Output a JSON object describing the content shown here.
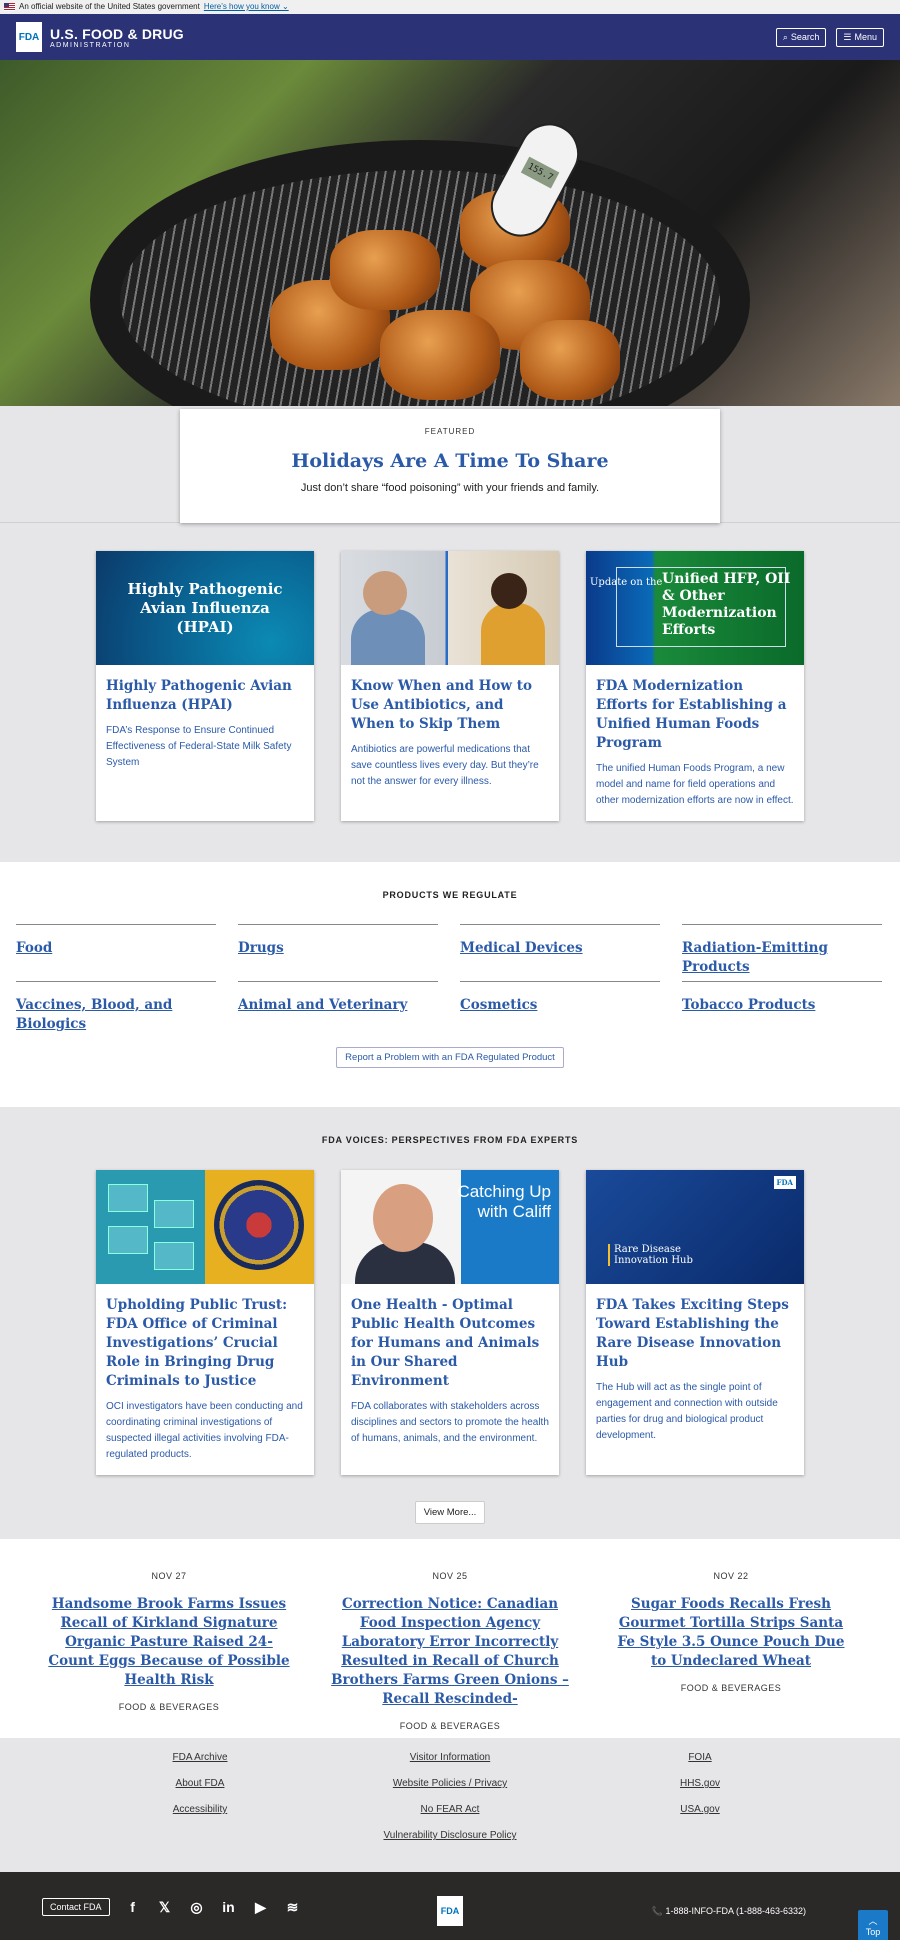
{
  "gov_banner": {
    "text": "An official website of the United States government",
    "link": "Here’s how you know ⌄"
  },
  "header": {
    "logo": "FDA",
    "title": "U.S. FOOD & DRUG",
    "subtitle": "ADMINISTRATION",
    "search_label": "Search",
    "menu_label": "Menu"
  },
  "hero": {
    "thermometer": "155.7"
  },
  "featured": {
    "kicker": "FEATURED",
    "title": "Holidays Are A Time To Share",
    "text": "Just don’t share “food poisoning” with your friends and family."
  },
  "top_cards": [
    {
      "image_text": "Highly Pathogenic Avian Influenza (HPAI)",
      "title": "Highly Pathogenic Avian Influenza (HPAI)",
      "text": "FDA’s Response to Ensure Continued Effectiveness of Federal-State Milk Safety System"
    },
    {
      "title": "Know When and How to Use Antibiotics, and When to Skip Them",
      "text": "Antibiotics are powerful medications that save countless lives every day. But they’re not the answer for every illness."
    },
    {
      "image_small": "Update on the",
      "image_big": "Unified HFP, OII & Other Modernization Efforts",
      "title": "FDA Modernization Efforts for Establishing a Unified Human Foods Program",
      "text": "The unified Human Foods Program, a new model and name for field operations and other modernization efforts are now in effect."
    }
  ],
  "products": {
    "title": "PRODUCTS WE REGULATE",
    "items": [
      "Food",
      "Drugs",
      "Medical Devices",
      "Radiation-Emitting Products",
      "Vaccines, Blood, and Biologics",
      "Animal and Veterinary",
      "Cosmetics",
      "Tobacco Products"
    ],
    "report_label": "Report a Problem with an FDA Regulated Product"
  },
  "voices": {
    "title": "FDA VOICES: PERSPECTIVES FROM FDA EXPERTS",
    "cards": [
      {
        "title": "Upholding Public Trust: FDA Office of Criminal Investigations’ Crucial Role in Bringing Drug Criminals to Justice",
        "text": "OCI investigators have been conducting and coordinating criminal investigations of suspected illegal activities involving FDA-regulated products."
      },
      {
        "image_text": "Catching Up with Califf",
        "title": "One Health - Optimal Public Health Outcomes for Humans and Animals in Our Shared Environment",
        "text": "FDA collaborates with stakeholders across disciplines and sectors to promote the health of humans, animals, and the environment."
      },
      {
        "image_text": "Rare Disease Innovation Hub",
        "image_logo": "FDA",
        "title": "FDA Takes Exciting Steps Toward Establishing the Rare Disease Innovation Hub",
        "text": "The Hub will act as the single point of engagement and connection with outside parties for drug and biological product development."
      }
    ],
    "view_more": "View More..."
  },
  "news": [
    {
      "date": "NOV 27",
      "title": "Handsome Brook Farms Issues Recall of Kirkland Signature Organic Pasture Raised 24-Count Eggs Because of Possible Health Risk",
      "category": "FOOD & BEVERAGES"
    },
    {
      "date": "NOV 25",
      "title": "Correction Notice: Canadian Food Inspection Agency Laboratory Error Incorrectly Resulted in Recall of Church Brothers Farms Green Onions – Recall Rescinded-",
      "category": "FOOD & BEVERAGES"
    },
    {
      "date": "NOV 22",
      "title": "Sugar Foods Recalls Fresh Gourmet Tortilla Strips Santa Fe Style 3.5 Ounce Pouch Due to Undeclared Wheat",
      "category": "FOOD & BEVERAGES"
    }
  ],
  "footer_links": {
    "rows": [
      [
        "FDA Archive",
        "Visitor Information",
        "FOIA"
      ],
      [
        "About FDA",
        "Website Policies / Privacy",
        "HHS.gov"
      ],
      [
        "Accessibility",
        "No FEAR Act",
        "USA.gov"
      ]
    ],
    "center": "Vulnerability Disclosure Policy"
  },
  "footer": {
    "contact": "Contact FDA",
    "logo": "FDA",
    "phone": "📞 1-888-INFO-FDA (1-888-463-6332)",
    "top": "Top"
  }
}
